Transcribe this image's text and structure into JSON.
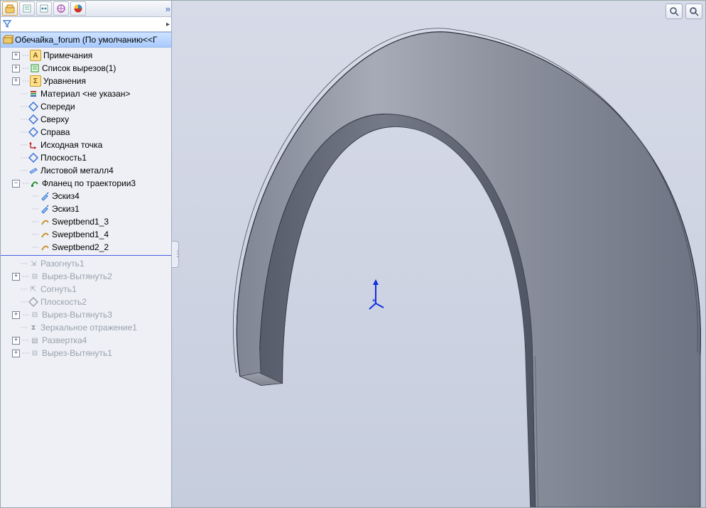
{
  "root": {
    "name": "Обечайка_forum  (По умолчанию<<Г"
  },
  "filter": {
    "placeholder": ""
  },
  "tree": [
    {
      "id": "annotations",
      "level": 1,
      "exp": "plus",
      "icon": "A-box",
      "label": "Примечания"
    },
    {
      "id": "cutlist",
      "level": 1,
      "exp": "plus",
      "icon": "cutlist",
      "label": "Список вырезов(1)"
    },
    {
      "id": "equations",
      "level": 1,
      "exp": "plus",
      "icon": "sigma",
      "label": "Уравнения"
    },
    {
      "id": "material",
      "level": 1,
      "exp": "blank",
      "icon": "material",
      "label": "Материал <не указан>"
    },
    {
      "id": "front",
      "level": 1,
      "exp": "blank",
      "icon": "plane",
      "label": "Спереди"
    },
    {
      "id": "top",
      "level": 1,
      "exp": "blank",
      "icon": "plane",
      "label": "Сверху"
    },
    {
      "id": "right",
      "level": 1,
      "exp": "blank",
      "icon": "plane",
      "label": "Справа"
    },
    {
      "id": "origin",
      "level": 1,
      "exp": "blank",
      "icon": "origin",
      "label": "Исходная точка"
    },
    {
      "id": "plane1",
      "level": 1,
      "exp": "blank",
      "icon": "plane",
      "label": "Плоскость1"
    },
    {
      "id": "sheetmetal4",
      "level": 1,
      "exp": "blank",
      "icon": "sheet",
      "label": "Листовой металл4"
    },
    {
      "id": "sweptflange3",
      "level": 1,
      "exp": "minus",
      "icon": "swept",
      "label": "Фланец по траектории3"
    },
    {
      "id": "sketch4",
      "level": 2,
      "exp": "blank",
      "icon": "sketch",
      "label": "Эскиз4"
    },
    {
      "id": "sketch1",
      "level": 2,
      "exp": "blank",
      "icon": "sketch",
      "label": "Эскиз1"
    },
    {
      "id": "sb13",
      "level": 2,
      "exp": "blank",
      "icon": "bend",
      "label": "Sweptbend1_3"
    },
    {
      "id": "sb14",
      "level": 2,
      "exp": "blank",
      "icon": "bend",
      "label": "Sweptbend1_4"
    },
    {
      "id": "sb22",
      "level": 2,
      "exp": "blank",
      "icon": "bend",
      "label": "Sweptbend2_2"
    },
    {
      "id": "sep",
      "separator": true
    },
    {
      "id": "unfold1",
      "level": 1,
      "exp": "blank",
      "icon": "unfold",
      "label": "Разогнуть1",
      "suppressed": true
    },
    {
      "id": "cutextrude2",
      "level": 1,
      "exp": "plus",
      "icon": "cut",
      "label": "Вырез-Вытянуть2",
      "suppressed": true
    },
    {
      "id": "fold1",
      "level": 1,
      "exp": "blank",
      "icon": "fold",
      "label": "Согнуть1",
      "suppressed": true
    },
    {
      "id": "plane2",
      "level": 1,
      "exp": "blank",
      "icon": "plane-g",
      "label": "Плоскость2",
      "suppressed": true
    },
    {
      "id": "cutextrude3",
      "level": 1,
      "exp": "plus",
      "icon": "cut",
      "label": "Вырез-Вытянуть3",
      "suppressed": true
    },
    {
      "id": "mirror1",
      "level": 1,
      "exp": "blank",
      "icon": "mirror",
      "label": "Зеркальное отражение1",
      "suppressed": true
    },
    {
      "id": "flatpattern4",
      "level": 1,
      "exp": "plus",
      "icon": "flat",
      "label": "Развертка4",
      "suppressed": true
    },
    {
      "id": "cutextrude1",
      "level": 1,
      "exp": "plus",
      "icon": "cut",
      "label": "Вырез-Вытянуть1",
      "suppressed": true
    }
  ],
  "icons": {
    "A-box": "A",
    "cutlist": "☐",
    "sigma": "Σ",
    "material": "≡",
    "plane": "◇",
    "plane-g": "◇",
    "origin": "↳",
    "sheet": "▭",
    "swept": "➰",
    "sketch": "✎",
    "bend": "⤻",
    "unfold": "⇲",
    "fold": "⇱",
    "cut": "⊟",
    "mirror": "⧗",
    "flat": "▤",
    "part": "📦"
  },
  "iconColors": {
    "A-box": "#f0aa30",
    "cutlist": "#2a8a30",
    "sigma": "#d08a00",
    "material": "#c03030",
    "plane": "#3a6fd8",
    "plane-g": "#9aa1ad",
    "origin": "#c03030",
    "sheet": "#3a6fd8",
    "swept": "#2a8a30",
    "sketch": "#2a6fcf",
    "bend": "#c88a20",
    "unfold": "#9aa1ad",
    "fold": "#9aa1ad",
    "cut": "#9aa1ad",
    "mirror": "#9aa1ad",
    "flat": "#9aa1ad",
    "part": "#c89a30"
  }
}
